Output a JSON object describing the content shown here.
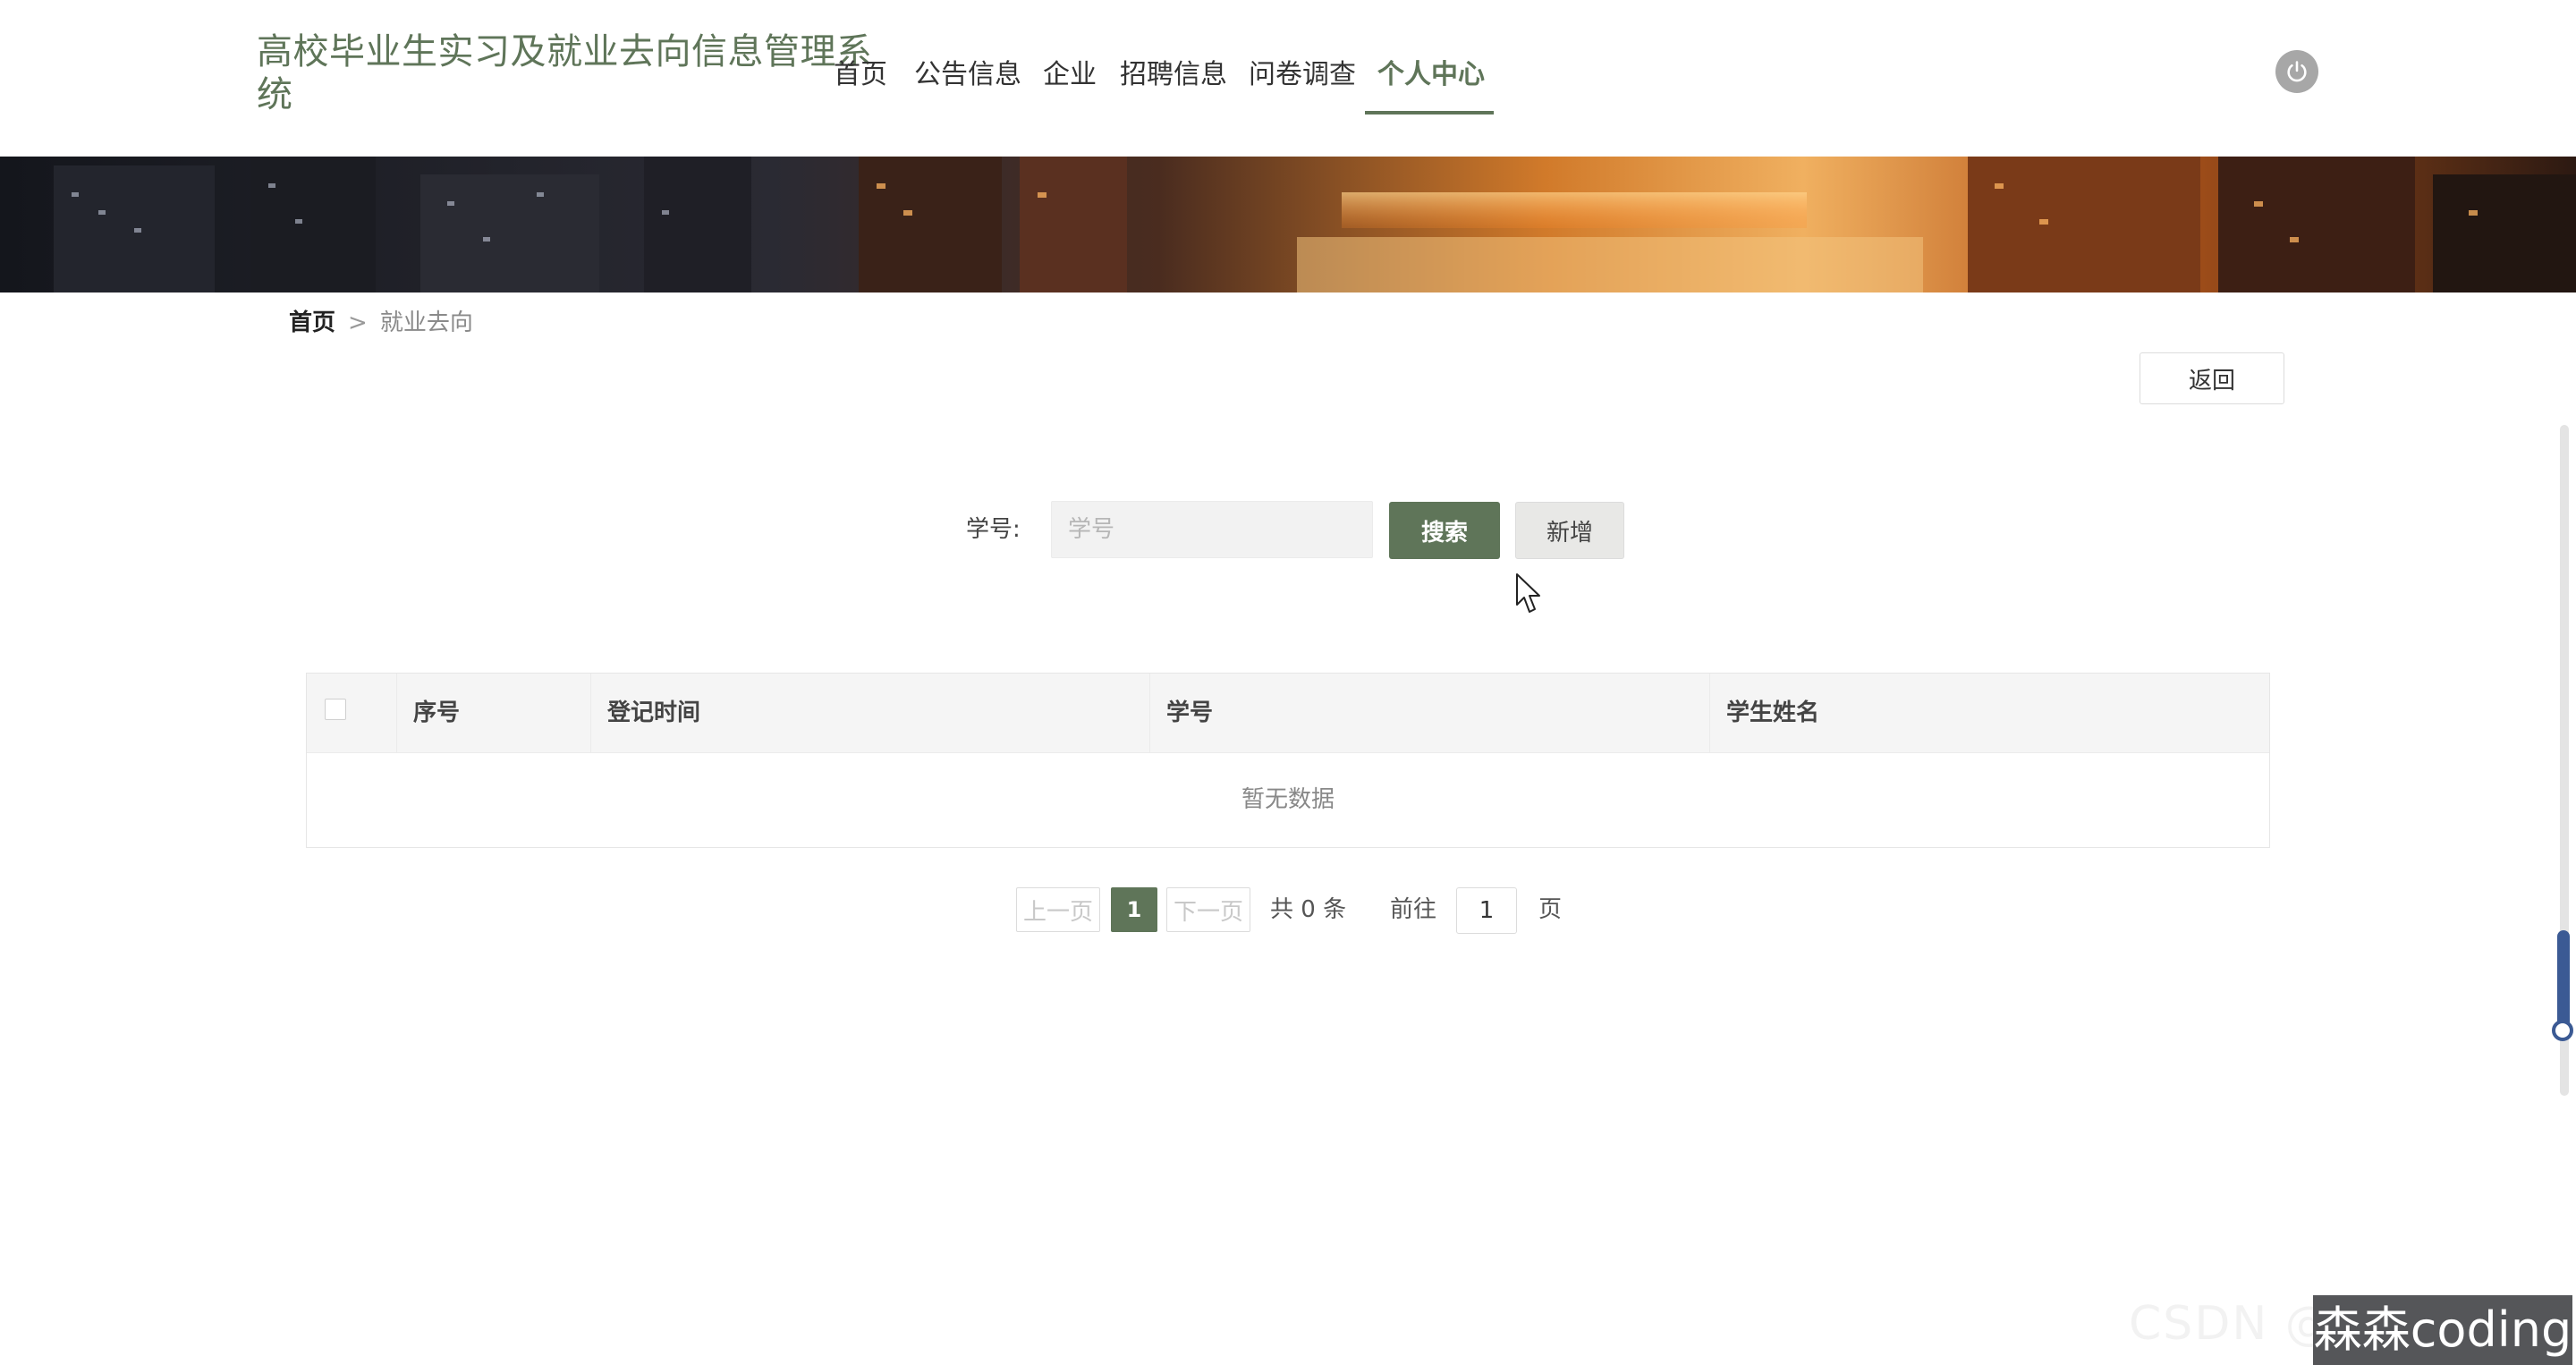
{
  "header": {
    "site_title": "高校毕业生实习及就业去向信息管理系统",
    "nav": [
      "首页",
      "公告信息",
      "企业",
      "招聘信息",
      "问卷调查",
      "个人中心"
    ],
    "active_nav": "个人中心"
  },
  "breadcrumb": {
    "home": "首页",
    "separator": ">",
    "current": "就业去向"
  },
  "actions": {
    "back_label": "返回"
  },
  "search": {
    "label": "学号:",
    "placeholder": "学号",
    "value": "",
    "search_label": "搜索",
    "add_label": "新增"
  },
  "table": {
    "columns": [
      "序号",
      "登记时间",
      "学号",
      "学生姓名"
    ],
    "rows": [],
    "empty_text": "暂无数据"
  },
  "pagination": {
    "prev_label": "上一页",
    "current_page": "1",
    "next_label": "下一页",
    "total_text": "共 0 条",
    "goto_label": "前往",
    "goto_value": "1",
    "page_unit": "页"
  },
  "watermark": {
    "text": "森森coding",
    "faint_text": "CSDN @"
  },
  "colors": {
    "primary": "#5f7559",
    "scroll_thumb": "#3b5a94"
  },
  "icons": {
    "power": "power-icon"
  }
}
